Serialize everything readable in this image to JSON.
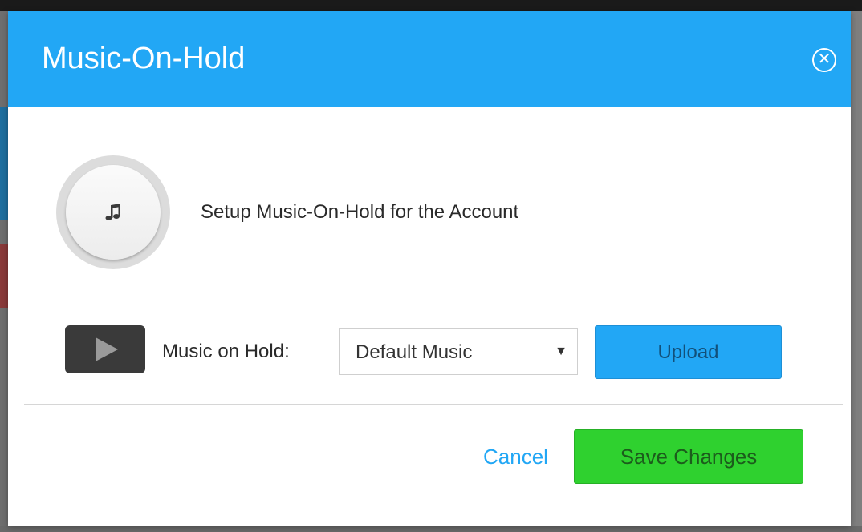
{
  "modal": {
    "title": "Music-On-Hold",
    "close_symbol": "✕",
    "intro_text": "Setup Music-On-Hold for the Account",
    "icon": "music-note-icon"
  },
  "settings": {
    "play_icon": "play-icon",
    "label": "Music on Hold:",
    "selected_music": "Default Music",
    "dropdown_arrow": "▼",
    "upload_label": "Upload"
  },
  "footer": {
    "cancel_label": "Cancel",
    "save_label": "Save Changes"
  },
  "colors": {
    "header": "#22a7f5",
    "upload": "#22a7f5",
    "save": "#2fd12f",
    "cancel_text": "#22a7f5"
  }
}
